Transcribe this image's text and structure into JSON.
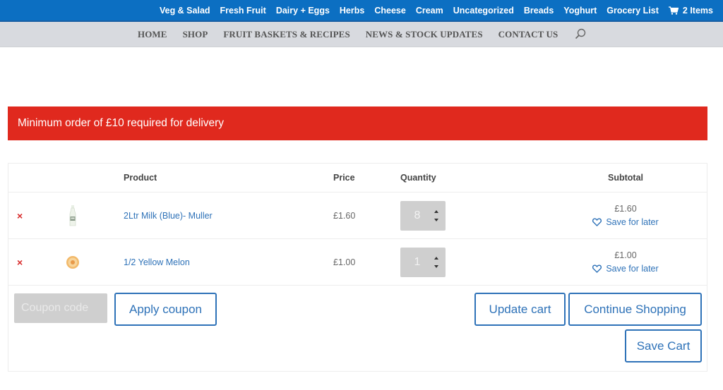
{
  "topbar": {
    "links": [
      "Veg & Salad",
      "Fresh Fruit",
      "Dairy + Eggs",
      "Herbs",
      "Cheese",
      "Cream",
      "Uncategorized",
      "Breads",
      "Yoghurt",
      "Grocery List"
    ],
    "cart_label": "2 Items",
    "cart_icon": "cart-icon"
  },
  "mainnav": {
    "items": [
      "HOME",
      "SHOP",
      "FRUIT BASKETS & RECIPES",
      "NEWS & STOCK UPDATES",
      "CONTACT US"
    ],
    "search_icon": "search-icon"
  },
  "notice": {
    "text": "Minimum order of £10 required for delivery",
    "color": "#e0291e"
  },
  "cart": {
    "headers": {
      "product": "Product",
      "price": "Price",
      "quantity": "Quantity",
      "subtotal": "Subtotal"
    },
    "items": [
      {
        "name": "2Ltr Milk (Blue)- Muller",
        "price": "£1.60",
        "quantity": "8",
        "subtotal": "£1.60",
        "save_label": "Save for later",
        "thumb": "milk-bottle"
      },
      {
        "name": "1/2 Yellow Melon",
        "price": "£1.00",
        "quantity": "1",
        "subtotal": "£1.00",
        "save_label": "Save for later",
        "thumb": "melon"
      }
    ],
    "remove_symbol": "×",
    "coupon_placeholder": "Coupon code",
    "apply_label": "Apply coupon",
    "update_label": "Update cart",
    "continue_label": "Continue Shopping",
    "save_cart_label": "Save Cart"
  },
  "colors": {
    "topbar": "#0c6fc2",
    "mainnav": "#d8dadf",
    "link": "#2e72b8",
    "remove": "#d82a2a"
  }
}
